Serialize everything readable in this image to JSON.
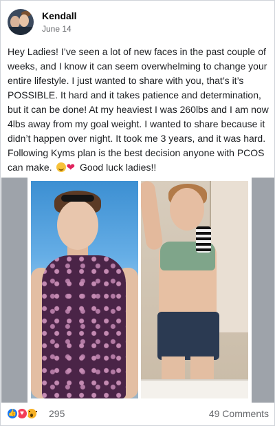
{
  "post": {
    "author": "Kendall",
    "date": "June 14",
    "text": "Hey Ladies! I’ve seen a lot of new faces in the past couple of weeks, and I know it can seem overwhelming to change your entire lifestyle. I just wanted to share with you, that’s it’s POSSIBLE. It hard and it takes patience and determination, but it can be done! At my heaviest I was 260lbs and I am now 4lbs away from my goal weight. I wanted to share because it didn’t happen over night. It took me 3 years, and it was hard. Following Kyms plan is the best decision anyone with PCOS can make.",
    "text_tail": "Good luck ladies!!",
    "emojis": [
      "smiling-face-icon",
      "red-heart-icon"
    ]
  },
  "photo": {
    "left_description_icon": "before-photo",
    "right_description_icon": "after-photo"
  },
  "footer": {
    "reaction_icons": [
      "like-icon",
      "love-icon",
      "wow-icon"
    ],
    "reaction_count": "295",
    "comment_count": "49 Comments"
  },
  "colors": {
    "like": "#1877f2",
    "love": "#f33e58",
    "wow": "#f7b125",
    "muted_text": "#65676b"
  }
}
